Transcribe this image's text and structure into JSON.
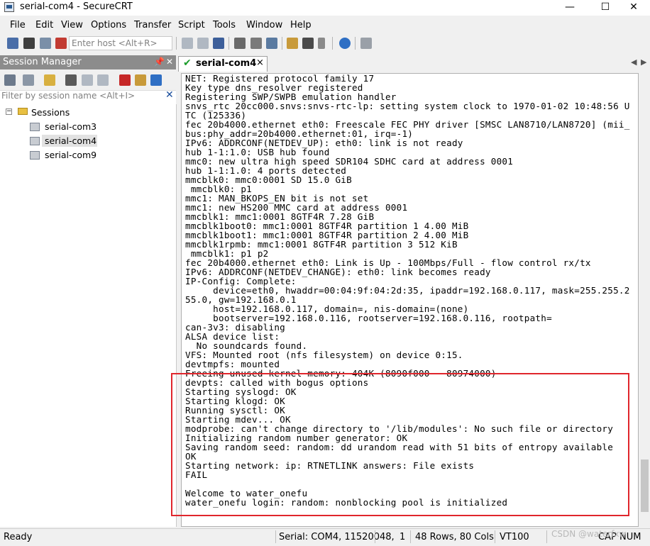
{
  "window": {
    "title": "serial-com4 - SecureCRT",
    "minimize": "—",
    "maximize": "☐",
    "close": "✕"
  },
  "menu": [
    "File",
    "Edit",
    "View",
    "Options",
    "Transfer",
    "Script",
    "Tools",
    "Window",
    "Help"
  ],
  "toolbar": {
    "host_placeholder": "Enter host <Alt+R>"
  },
  "session_manager": {
    "title": "Session Manager",
    "pin": "📌",
    "close": "✕",
    "filter_placeholder": "Filter by session name <Alt+I>",
    "root": "Sessions",
    "items": [
      "serial-com3",
      "serial-com4",
      "serial-com9"
    ],
    "selected": "serial-com4"
  },
  "tab": {
    "label": "serial-com4",
    "close": "×"
  },
  "terminal": {
    "lines": [
      "NET: Registered protocol family 17",
      "Key type dns_resolver registered",
      "Registering SWP/SWPB emulation handler",
      "snvs_rtc 20cc000.snvs:snvs-rtc-lp: setting system clock to 1970-01-02 10:48:56 U",
      "TC (125336)",
      "fec 20b4000.ethernet eth0: Freescale FEC PHY driver [SMSC LAN8710/LAN8720] (mii_",
      "bus:phy_addr=20b4000.ethernet:01, irq=-1)",
      "IPv6: ADDRCONF(NETDEV_UP): eth0: link is not ready",
      "hub 1-1:1.0: USB hub found",
      "mmc0: new ultra high speed SDR104 SDHC card at address 0001",
      "hub 1-1:1.0: 4 ports detected",
      "mmcblk0: mmc0:0001 SD 15.0 GiB",
      " mmcblk0: p1",
      "mmc1: MAN_BKOPS_EN bit is not set",
      "mmc1: new HS200 MMC card at address 0001",
      "mmcblk1: mmc1:0001 8GTF4R 7.28 GiB",
      "mmcblk1boot0: mmc1:0001 8GTF4R partition 1 4.00 MiB",
      "mmcblk1boot1: mmc1:0001 8GTF4R partition 2 4.00 MiB",
      "mmcblk1rpmb: mmc1:0001 8GTF4R partition 3 512 KiB",
      " mmcblk1: p1 p2",
      "fec 20b4000.ethernet eth0: Link is Up - 100Mbps/Full - flow control rx/tx",
      "IPv6: ADDRCONF(NETDEV_CHANGE): eth0: link becomes ready",
      "IP-Config: Complete:",
      "     device=eth0, hwaddr=00:04:9f:04:2d:35, ipaddr=192.168.0.117, mask=255.255.2",
      "55.0, gw=192.168.0.1",
      "     host=192.168.0.117, domain=, nis-domain=(none)",
      "     bootserver=192.168.0.116, rootserver=192.168.0.116, rootpath=",
      "can-3v3: disabling",
      "ALSA device list:",
      "  No soundcards found.",
      "VFS: Mounted root (nfs filesystem) on device 0:15.",
      "devtmpfs: mounted",
      "Freeing unused kernel memory: 404K (8090f000 - 80974000)",
      "devpts: called with bogus options",
      "Starting syslogd: OK",
      "Starting klogd: OK",
      "Running sysctl: OK",
      "Starting mdev... OK",
      "modprobe: can't change directory to '/lib/modules': No such file or directory",
      "Initializing random number generator: OK",
      "Saving random seed: random: dd urandom read with 51 bits of entropy available",
      "OK",
      "Starting network: ip: RTNETLINK answers: File exists",
      "FAIL",
      "",
      "Welcome to water_onefu",
      "water_onefu login: random: nonblocking pool is initialized"
    ]
  },
  "statusbar": {
    "ready": "Ready",
    "serial": "Serial: COM4, 115200",
    "row": "48,",
    "col": "1",
    "size": "48 Rows, 80 Cols",
    "emulation": "VT100",
    "caps": "CAP",
    "num": "NUM"
  },
  "watermark": "CSDN @waterfxw",
  "colors": {
    "highlight_box": "#e0262c",
    "panel_header": "#8c8c8c",
    "tab_check": "#1a9c2a"
  }
}
